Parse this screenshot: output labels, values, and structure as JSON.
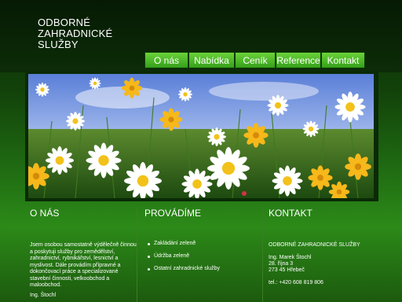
{
  "header": {
    "title": "ODBORNÉ ZAHRADNICKÉ SLUŽBY"
  },
  "nav": [
    {
      "label": "O nás"
    },
    {
      "label": "Nabídka"
    },
    {
      "label": "Ceník"
    },
    {
      "label": "Reference"
    },
    {
      "label": "Kontakt"
    }
  ],
  "about": {
    "title": "O NÁS",
    "text": "Jsem osobou samostatně výdělečně činnou a poskytuji služby pro zemědělství, zahradnictví, rybnikářství, lesnictví a myslivost. Dále provádím přípravné a dokončovací práce a specializované stavební činnosti, velkoobchod a maloobchod.",
    "signature": "Ing. Štochl"
  },
  "services": {
    "title": "PROVÁDÍME",
    "items": [
      "Zakládání zeleně",
      "Údržba zeleně",
      "Ostatní zahradnické služby"
    ]
  },
  "contact": {
    "title": "KONTAKT",
    "company": "ODBORNÉ ZAHRADNICKÉ SLUŽBY",
    "name": "Ing. Marek Štochl",
    "street": "28. října 3",
    "city": "273 45 Hřebeč",
    "phone": "tel.: +420 608 819 806"
  },
  "colors": {
    "nav_top": "#6bd23a",
    "nav_bottom": "#35a01a",
    "background": "#1f6a12"
  }
}
